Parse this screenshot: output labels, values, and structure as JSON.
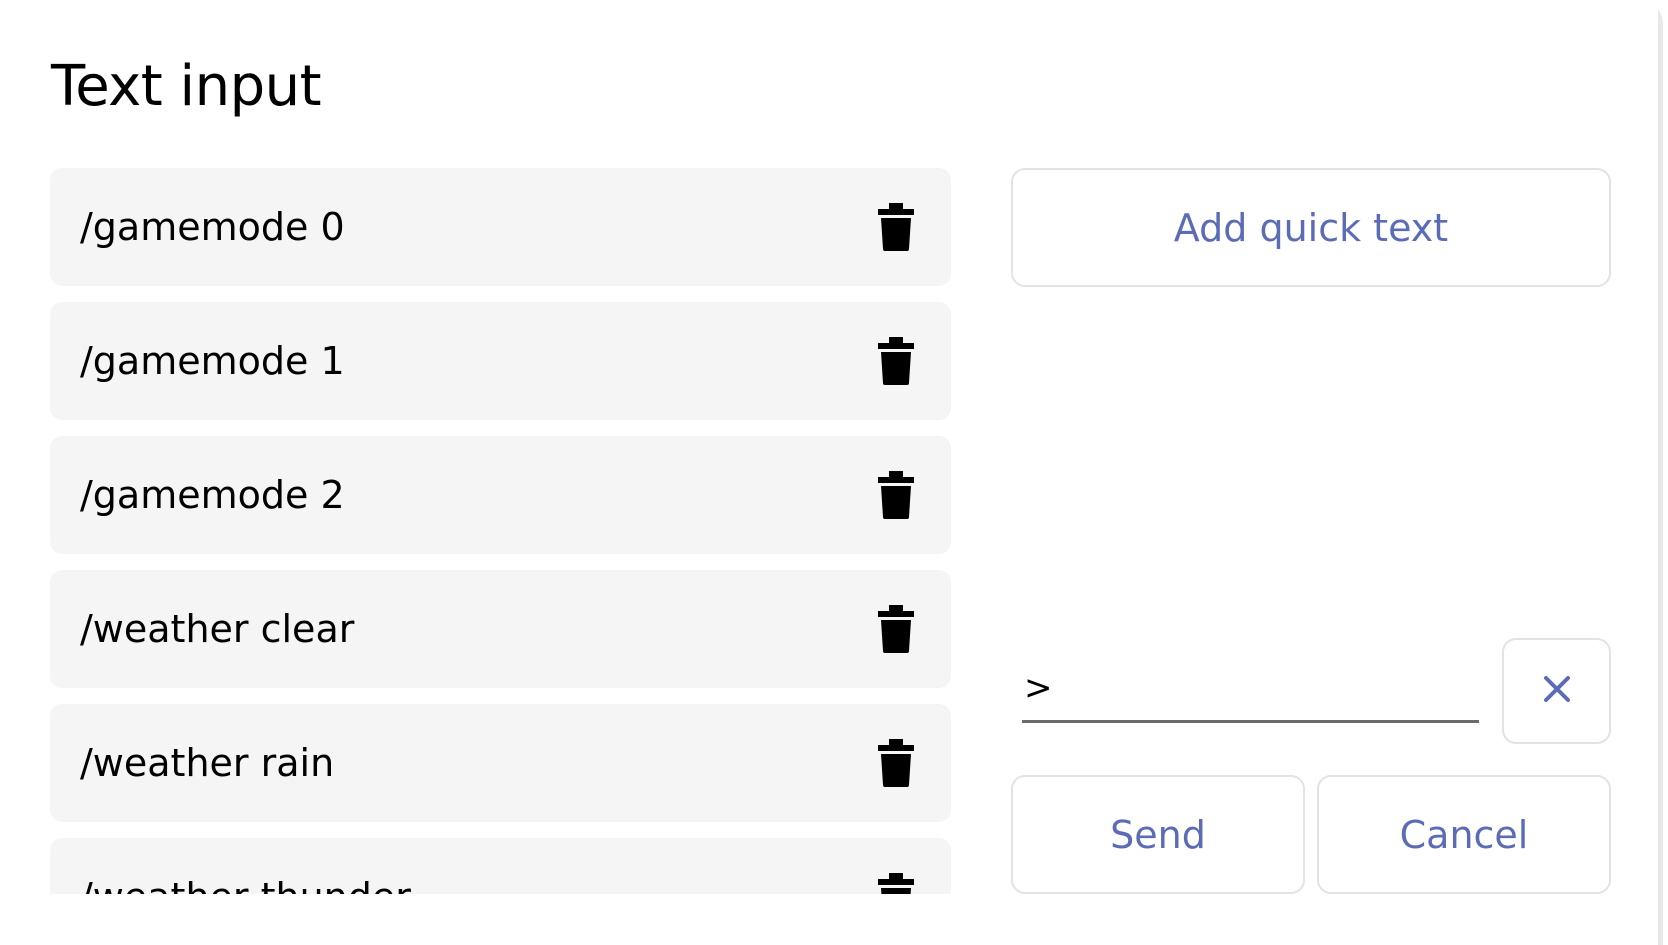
{
  "dialog": {
    "title": "Text input"
  },
  "quick_texts": [
    {
      "label": "/gamemode 0",
      "delete_icon": "trash-icon"
    },
    {
      "label": "/gamemode 1",
      "delete_icon": "trash-icon"
    },
    {
      "label": "/gamemode 2",
      "delete_icon": "trash-icon"
    },
    {
      "label": "/weather clear",
      "delete_icon": "trash-icon"
    },
    {
      "label": "/weather rain",
      "delete_icon": "trash-icon"
    },
    {
      "label": "/weather thunder",
      "delete_icon": "trash-icon"
    }
  ],
  "actions": {
    "add_quick_text": "Add quick text",
    "send": "Send",
    "cancel": "Cancel",
    "clear_icon": "close-icon"
  },
  "input": {
    "prompt": ">",
    "value": ""
  },
  "colors": {
    "accent": "#5c6bb5",
    "item_background": "#f5f5f5",
    "border": "#e3e3e6"
  }
}
